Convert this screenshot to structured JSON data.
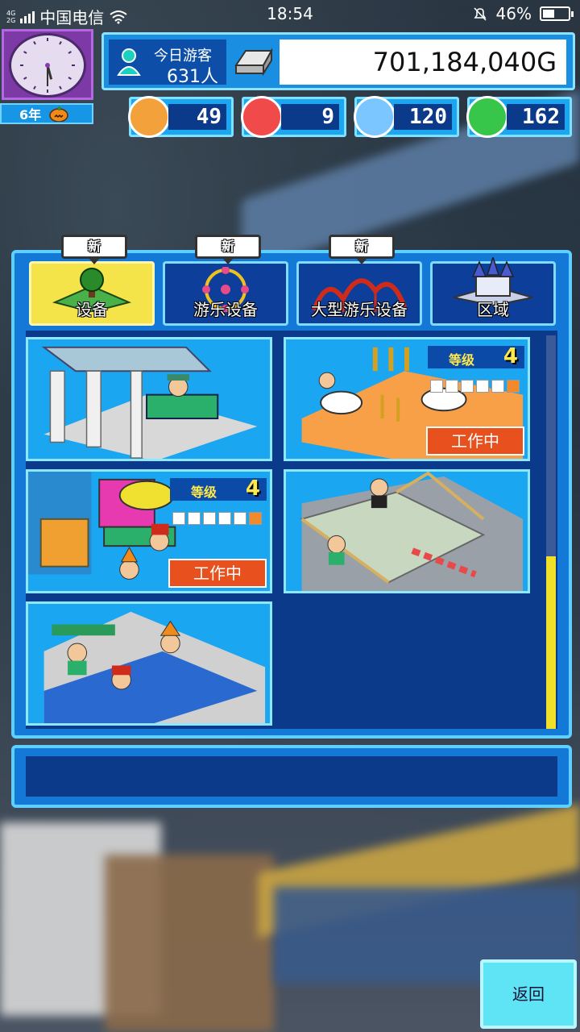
{
  "status_bar": {
    "network_tags": [
      "4G",
      "2G"
    ],
    "carrier": "中国电信",
    "time": "18:54",
    "battery": "46%",
    "battery_level": 0.46
  },
  "calendar": {
    "year_label": "6年",
    "clock_hour": 5,
    "clock_minute": 30
  },
  "info": {
    "visitors_label": "今日游客",
    "visitors_value": "631人",
    "money": "701,184,040G"
  },
  "resources": [
    {
      "name": "happy",
      "icon": "orange-face-icon",
      "value": "49",
      "color": "#f3a13a"
    },
    {
      "name": "fire",
      "icon": "fire-icon",
      "value": "9",
      "color": "#f04a4a"
    },
    {
      "name": "water",
      "icon": "water-drop-icon",
      "value": "120",
      "color": "#7cc6ff"
    },
    {
      "name": "leaf",
      "icon": "green-leaf-icon",
      "value": "162",
      "color": "#38c64a"
    }
  ],
  "tabs": [
    {
      "label": "设备",
      "new": "新",
      "active": true
    },
    {
      "label": "游乐设备",
      "new": "新",
      "active": false
    },
    {
      "label": "大型游乐设备",
      "new": "新",
      "active": false
    },
    {
      "label": "区域",
      "new": "",
      "active": false
    }
  ],
  "facilities": [
    {
      "name": "ticket-booth",
      "level_label": "",
      "level": "",
      "status": ""
    },
    {
      "name": "pony-ride",
      "level_label": "等级",
      "level": "4",
      "status": "工作中"
    },
    {
      "name": "shop-plaza",
      "level_label": "等级",
      "level": "4",
      "status": "工作中"
    },
    {
      "name": "stairs-bridge",
      "level_label": "",
      "level": "",
      "status": ""
    },
    {
      "name": "pool-area",
      "level_label": "",
      "level": "",
      "status": ""
    }
  ],
  "back_label": "返回",
  "colors": {
    "panel": "#1478d6",
    "panel_border": "#5ed0ff",
    "active_tab": "#f4e44a",
    "working": "#e8501e",
    "scroll_thumb": "#f0e02a"
  }
}
